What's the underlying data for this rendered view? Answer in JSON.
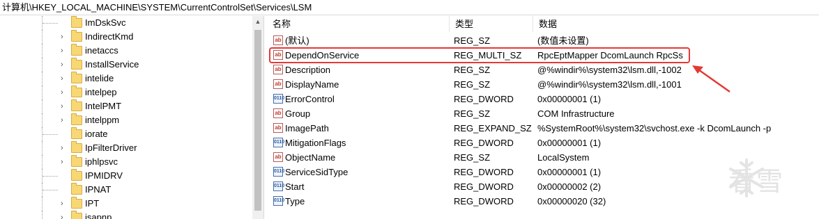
{
  "address_bar": {
    "path": "计算机\\HKEY_LOCAL_MACHINE\\SYSTEM\\CurrentControlSet\\Services\\LSM"
  },
  "tree": {
    "items": [
      {
        "label": "ImDskSvc",
        "has_children": false
      },
      {
        "label": "IndirectKmd",
        "has_children": true
      },
      {
        "label": "inetaccs",
        "has_children": true
      },
      {
        "label": "InstallService",
        "has_children": true
      },
      {
        "label": "intelide",
        "has_children": true
      },
      {
        "label": "intelpep",
        "has_children": true
      },
      {
        "label": "IntelPMT",
        "has_children": true
      },
      {
        "label": "intelppm",
        "has_children": true
      },
      {
        "label": "iorate",
        "has_children": false
      },
      {
        "label": "IpFilterDriver",
        "has_children": true
      },
      {
        "label": "iphlpsvc",
        "has_children": true
      },
      {
        "label": "IPMIDRV",
        "has_children": false
      },
      {
        "label": "IPNAT",
        "has_children": false
      },
      {
        "label": "IPT",
        "has_children": true
      },
      {
        "label": "isapnp",
        "has_children": true
      }
    ]
  },
  "list": {
    "headers": {
      "name": "名称",
      "type": "类型",
      "data": "数据"
    },
    "rows": [
      {
        "name": "(默认)",
        "type": "REG_SZ",
        "data": "(数值未设置)",
        "icon": "string-value-icon"
      },
      {
        "name": "DependOnService",
        "type": "REG_MULTI_SZ",
        "data": "RpcEptMapper DcomLaunch RpcSs",
        "icon": "string-value-icon"
      },
      {
        "name": "Description",
        "type": "REG_SZ",
        "data": "@%windir%\\system32\\lsm.dll,-1002",
        "icon": "string-value-icon"
      },
      {
        "name": "DisplayName",
        "type": "REG_SZ",
        "data": "@%windir%\\system32\\lsm.dll,-1001",
        "icon": "string-value-icon"
      },
      {
        "name": "ErrorControl",
        "type": "REG_DWORD",
        "data": "0x00000001 (1)",
        "icon": "binary-value-icon"
      },
      {
        "name": "Group",
        "type": "REG_SZ",
        "data": "COM Infrastructure",
        "icon": "string-value-icon"
      },
      {
        "name": "ImagePath",
        "type": "REG_EXPAND_SZ",
        "data": "%SystemRoot%\\system32\\svchost.exe -k DcomLaunch -p",
        "icon": "string-value-icon"
      },
      {
        "name": "MitigationFlags",
        "type": "REG_DWORD",
        "data": "0x00000001 (1)",
        "icon": "binary-value-icon"
      },
      {
        "name": "ObjectName",
        "type": "REG_SZ",
        "data": "LocalSystem",
        "icon": "string-value-icon"
      },
      {
        "name": "ServiceSidType",
        "type": "REG_DWORD",
        "data": "0x00000001 (1)",
        "icon": "binary-value-icon"
      },
      {
        "name": "Start",
        "type": "REG_DWORD",
        "data": "0x00000002 (2)",
        "icon": "binary-value-icon"
      },
      {
        "name": "Type",
        "type": "REG_DWORD",
        "data": "0x00000020 (32)",
        "icon": "binary-value-icon"
      }
    ]
  },
  "annotation": {
    "highlight_color": "#e53935",
    "highlighted_row": "DependOnService"
  },
  "watermark": {
    "text": "看雪"
  }
}
